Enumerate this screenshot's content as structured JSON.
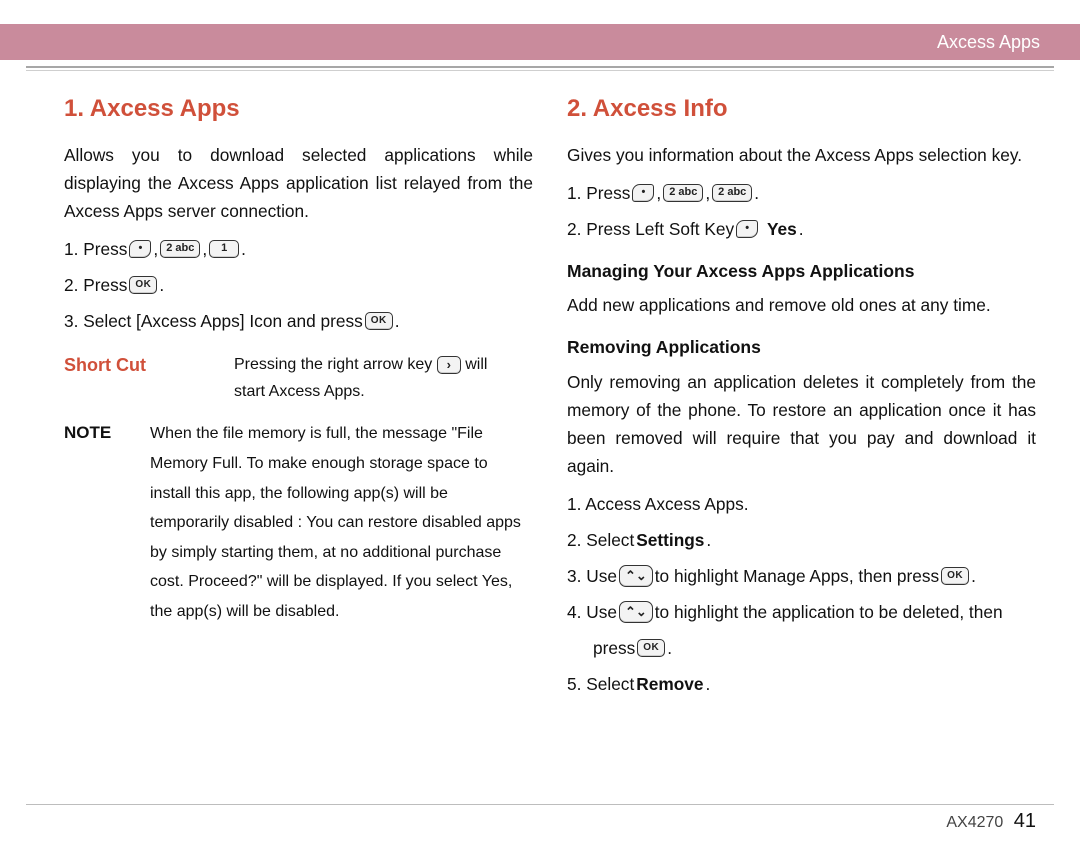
{
  "header": {
    "title": "Axcess Apps"
  },
  "footer": {
    "model": "AX4270",
    "page": "41"
  },
  "keys": {
    "soft": "•",
    "ok": "OK",
    "k2": "2 abc",
    "k1": "1",
    "right": "›",
    "navUp": "⌃",
    "navDown": "⌄",
    "navBoth": "⌃⌄"
  },
  "left": {
    "heading": "1. Axcess Apps",
    "intro": "Allows you to download selected applications while displaying the Axcess Apps application list relayed from the Axcess Apps server connection.",
    "s1a": "1.  Press ",
    "s2a": "2.  Press ",
    "s3a": "3.  Select [Axcess Apps] Icon and press ",
    "shortcutLabel": "Short Cut",
    "shortcutL1a": "Pressing the right arrow key ",
    "shortcutL1b": " will",
    "shortcutL2": "start Axcess Apps.",
    "noteLabel": "NOTE",
    "note1": "When the file memory is full, the message \"File",
    "note2": "Memory Full. To make enough storage space to",
    "note3": "install this app, the following app(s) will be",
    "note4": "temporarily disabled :  You can restore disabled apps",
    "note5": "by simply starting them, at no additional purchase",
    "note6": "cost. Proceed?\" will be displayed. If you select Yes,",
    "note7": "the app(s) will be disabled."
  },
  "right": {
    "heading": "2. Axcess Info",
    "intro": "Gives you information about the Axcess Apps selection key.",
    "s1a": "1.  Press ",
    "s2a": "2.  Press Left Soft Key ",
    "s2b": "Yes",
    "subManage": "Managing Your Axcess Apps Applications",
    "managePara": "Add new applications and remove old ones at any time.",
    "subRemove": "Removing Applications",
    "removePara": "Only removing an application deletes it completely from the memory of the phone. To restore an application once it has been removed will require that you pay and download it again.",
    "r1": "1.   Access Axcess Apps.",
    "r2a": "2.   Select ",
    "r2b": "Settings",
    "r3a": "3.  Use ",
    "r3b": " to highlight Manage Apps, then press ",
    "r4a": "4.  Use ",
    "r4b": " to highlight the application to be deleted, then",
    "r4c": "press ",
    "r5a": "5.   Select ",
    "r5b": "Remove"
  }
}
